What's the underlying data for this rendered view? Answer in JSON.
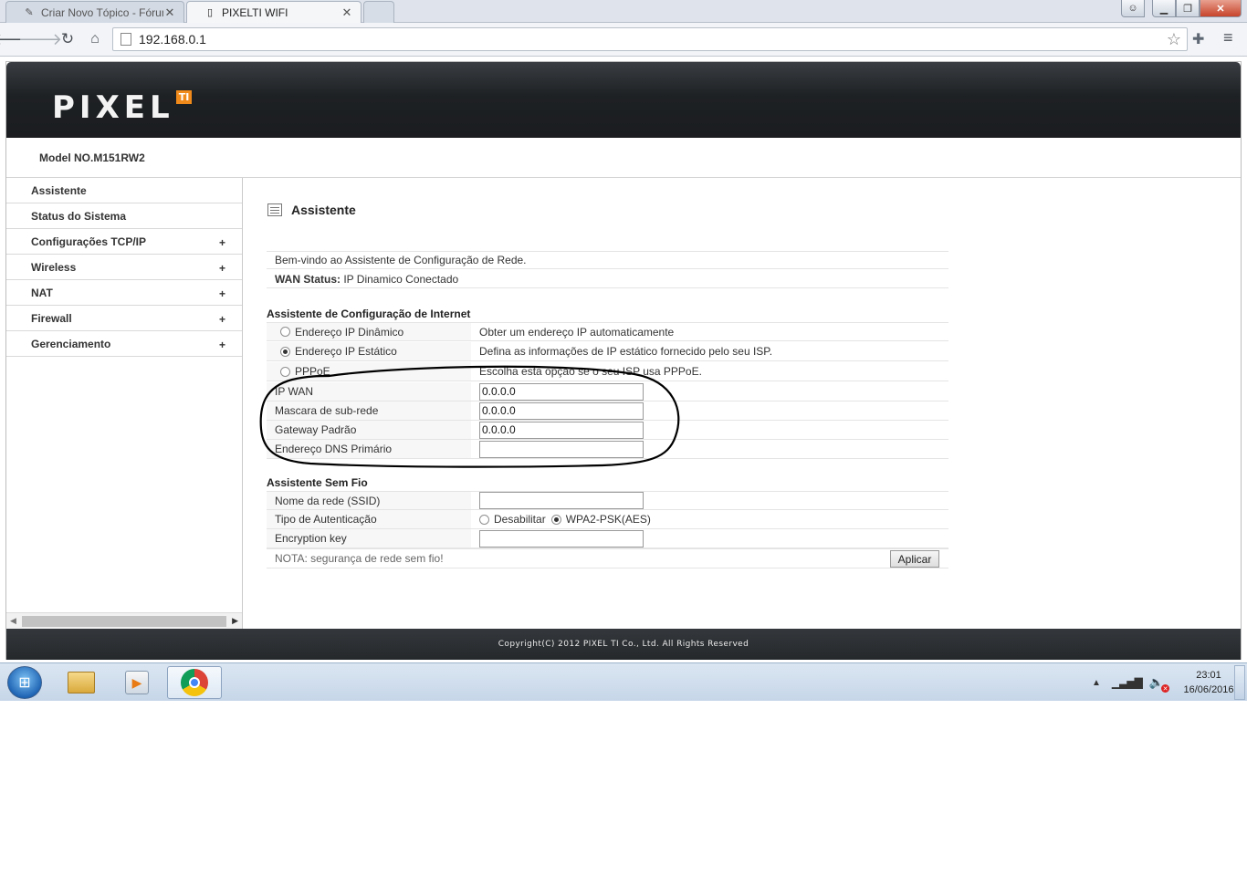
{
  "browser": {
    "tabs": [
      {
        "label": "Criar Novo Tópico - Fórum",
        "active": false
      },
      {
        "label": "PIXELTI WIFI",
        "active": true
      }
    ],
    "url": "192.168.0.1"
  },
  "router": {
    "logo_text": "PIXEL",
    "logo_badge": "TI",
    "model": "Model NO.M151RW2",
    "menu": [
      {
        "label": "Assistente",
        "expandable": false
      },
      {
        "label": "Status do Sistema",
        "expandable": false
      },
      {
        "label": "Configurações TCP/IP",
        "expandable": true
      },
      {
        "label": "Wireless",
        "expandable": true
      },
      {
        "label": "NAT",
        "expandable": true
      },
      {
        "label": "Firewall",
        "expandable": true
      },
      {
        "label": "Gerenciamento",
        "expandable": true
      }
    ],
    "menu_expand_glyph": "+",
    "content": {
      "title": "Assistente",
      "welcome": "Bem-vindo ao Assistente de Configuração de Rede.",
      "wan_status_label": "WAN Status:",
      "wan_status_value": "IP Dinamico Conectado",
      "internet_section": "Assistente de Configuração de Internet",
      "connection_types": [
        {
          "label": "Endereço IP Dinâmico",
          "description": "Obter um endereço IP automaticamente",
          "selected": false
        },
        {
          "label": "Endereço IP Estático",
          "description": "Defina as informações de IP estático fornecido pelo seu ISP.",
          "selected": true
        },
        {
          "label": "PPPoE",
          "description": "Escolha esta opção se o seu ISP usa PPPoE.",
          "selected": false
        }
      ],
      "static_fields": [
        {
          "label": "IP WAN",
          "value": "0.0.0.0"
        },
        {
          "label": "Mascara de sub-rede",
          "value": "0.0.0.0"
        },
        {
          "label": "Gateway Padrão",
          "value": "0.0.0.0"
        },
        {
          "label": "Endereço DNS Primário",
          "value": ""
        }
      ],
      "wireless_section": "Assistente Sem Fio",
      "ssid_label": "Nome da rede (SSID)",
      "ssid_value": "",
      "auth_label": "Tipo de Autenticação",
      "auth_options": [
        {
          "label": "Desabilitar",
          "selected": false
        },
        {
          "label": "WPA2-PSK(AES)",
          "selected": true
        }
      ],
      "key_label": "Encryption key",
      "key_value": "",
      "note": "NOTA: segurança de rede sem fio!",
      "apply_label": "Aplicar"
    },
    "footer": "Copyright(C) 2012 PIXEL TI Co., Ltd.   All Rights Reserved"
  },
  "taskbar": {
    "time": "23:01",
    "date": "16/06/2016"
  },
  "icons": {
    "back": "back-arrow-icon",
    "forward": "forward-arrow-icon",
    "reload": "reload-icon",
    "home": "home-icon",
    "bookmark": "star-icon",
    "extensions": "puzzle-icon",
    "menu": "hamburger-menu-icon"
  },
  "colors": {
    "banner": "#1e2124",
    "logo_badge": "#f08a1a",
    "annotation_stroke": "#000000"
  }
}
